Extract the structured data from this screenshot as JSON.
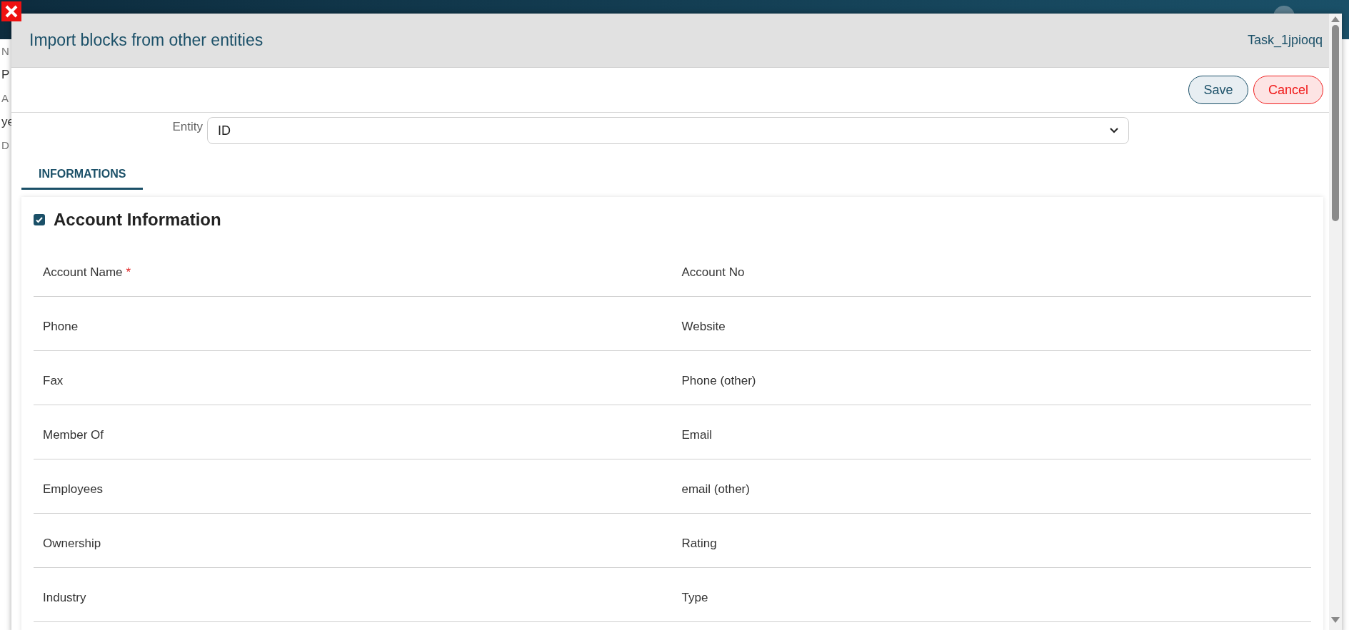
{
  "background": {
    "side_texts": [
      "N",
      "P",
      "A",
      "ye",
      "D"
    ]
  },
  "dialog": {
    "title": "Import blocks from other entities",
    "task": "Task_1jpioqq",
    "buttons": [
      {
        "label": "Save",
        "kind": "save"
      },
      {
        "label": "Cancel",
        "kind": "cancel"
      }
    ],
    "entity": {
      "label": "Entity",
      "value": "ID"
    },
    "tabs": [
      {
        "label": "INFORMATIONS",
        "selected": true
      }
    ],
    "section": {
      "title": "Account Information",
      "checked": true,
      "fields": [
        {
          "label": "Account Name",
          "marker": "*"
        },
        {
          "label": "Account No"
        },
        {
          "label": "Phone"
        },
        {
          "label": "Website"
        },
        {
          "label": "Fax"
        },
        {
          "label": "Phone (other)"
        },
        {
          "label": "Member Of"
        },
        {
          "label": "Email"
        },
        {
          "label": "Employees"
        },
        {
          "label": "email (other)"
        },
        {
          "label": "Ownership"
        },
        {
          "label": "Rating"
        },
        {
          "label": "Industry"
        },
        {
          "label": "Type"
        }
      ]
    }
  }
}
